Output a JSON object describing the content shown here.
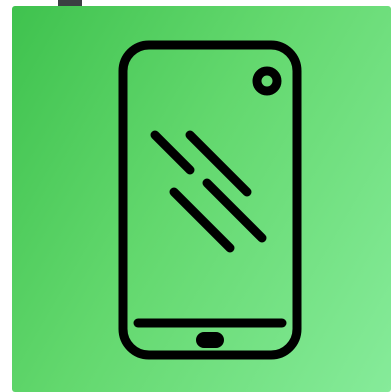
{
  "app": {
    "accent_color": "#4cca5a",
    "icon_color": "#000000"
  },
  "tile": {
    "icon": "smartphone-cracked-screen-icon"
  }
}
